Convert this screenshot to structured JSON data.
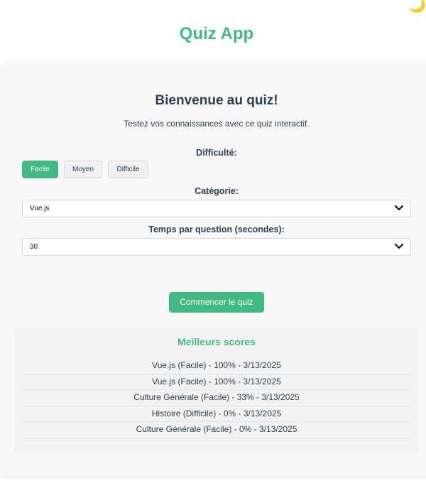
{
  "theme_toggle": {
    "icon": "moon-icon",
    "glyph": "🌙"
  },
  "app": {
    "title": "Quiz App"
  },
  "welcome": {
    "title": "Bienvenue au quiz!",
    "subtitle": "Testez vos connaissances avec ce quiz interactif."
  },
  "difficulty": {
    "label": "Difficulté:",
    "options": [
      {
        "label": "Facile",
        "active": true
      },
      {
        "label": "Moyen",
        "active": false
      },
      {
        "label": "Difficile",
        "active": false
      }
    ]
  },
  "category": {
    "label": "Catégorie:",
    "selected": "Vue.js"
  },
  "time": {
    "label": "Temps par question (secondes):",
    "selected": "30"
  },
  "start_button": {
    "label": "Commencer le quiz"
  },
  "scores": {
    "title": "Meilleurs scores",
    "items": [
      "Vue.js (Facile) - 100% - 3/13/2025",
      "Vue.js (Facile) - 100% - 3/13/2025",
      "Culture Générale (Facile) - 33% - 3/13/2025",
      "Histoire (Difficile) - 0% - 3/13/2025",
      "Culture Générale (Facile) - 0% - 3/13/2025"
    ]
  },
  "colors": {
    "accent": "#42b983",
    "text": "#2c3e50",
    "card_background": "#f8f8f8"
  }
}
